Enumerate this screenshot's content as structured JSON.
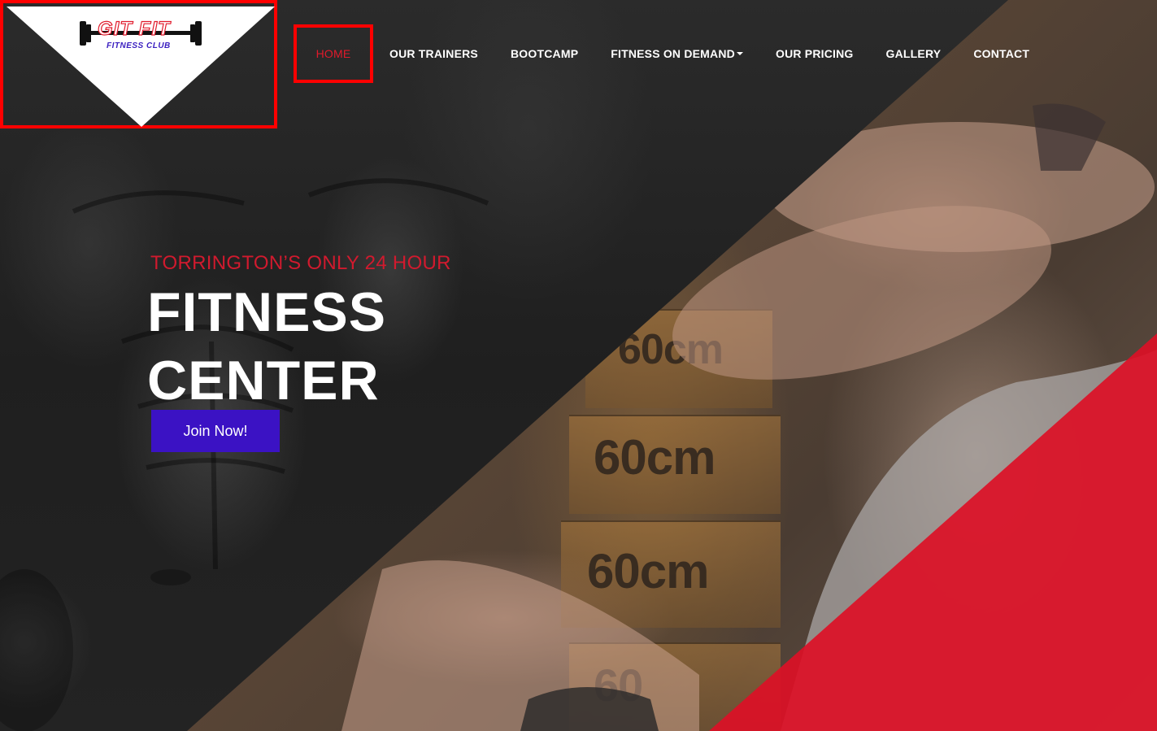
{
  "brand": {
    "logo_main": "GIT FIT",
    "logo_sub": "FITNESS CLUB",
    "accent_red": "#e01a2b",
    "accent_blue": "#3b12c4"
  },
  "nav": {
    "items": [
      {
        "label": "HOME",
        "active": true
      },
      {
        "label": "OUR TRAINERS"
      },
      {
        "label": "BOOTCAMP"
      },
      {
        "label": "FITNESS ON DEMAND",
        "has_dropdown": true
      },
      {
        "label": "OUR PRICING"
      },
      {
        "label": "GALLERY"
      },
      {
        "label": "CONTACT"
      }
    ]
  },
  "hero": {
    "eyebrow": "TORRINGTON’S ONLY 24 HOUR",
    "headline_line1": "FITNESS",
    "headline_line2": "CENTER",
    "cta_label": "Join Now!",
    "box_labels": [
      "60cm",
      "60cm",
      "60cm",
      "60"
    ]
  },
  "icons": {
    "dropdown": "caret-down-icon",
    "logo_barbell": "barbell-icon"
  }
}
